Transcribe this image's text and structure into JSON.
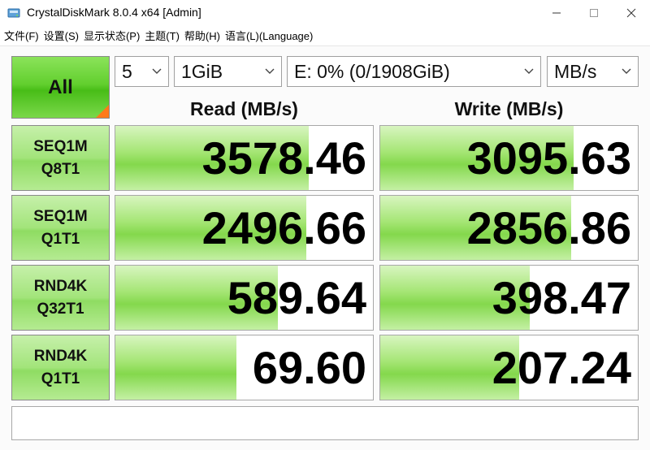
{
  "window": {
    "title": "CrystalDiskMark 8.0.4 x64 [Admin]"
  },
  "menu": [
    {
      "label": "文件(F)"
    },
    {
      "label": "设置(S)"
    },
    {
      "label": "显示状态(P)"
    },
    {
      "label": "主题(T)"
    },
    {
      "label": "帮助(H)"
    },
    {
      "label": "语言(L)(Language)"
    }
  ],
  "controls": {
    "all_label": "All",
    "count_value": "5",
    "size_value": "1GiB",
    "drive_value": "E: 0% (0/1908GiB)",
    "unit_value": "MB/s"
  },
  "headers": {
    "read": "Read (MB/s)",
    "write": "Write (MB/s)"
  },
  "tests": [
    {
      "line1": "SEQ1M",
      "line2": "Q8T1",
      "read": "3578.46",
      "write": "3095.63",
      "read_fill": 0.75,
      "write_fill": 0.75
    },
    {
      "line1": "SEQ1M",
      "line2": "Q1T1",
      "read": "2496.66",
      "write": "2856.86",
      "read_fill": 0.74,
      "write_fill": 0.74
    },
    {
      "line1": "RND4K",
      "line2": "Q32T1",
      "read": "589.64",
      "write": "398.47",
      "read_fill": 0.63,
      "write_fill": 0.58
    },
    {
      "line1": "RND4K",
      "line2": "Q1T1",
      "read": "69.60",
      "write": "207.24",
      "read_fill": 0.47,
      "write_fill": 0.54
    }
  ],
  "colors": {
    "accent_green": "#62cf2e",
    "corner_orange": "#ff7a1a"
  },
  "comment": ""
}
